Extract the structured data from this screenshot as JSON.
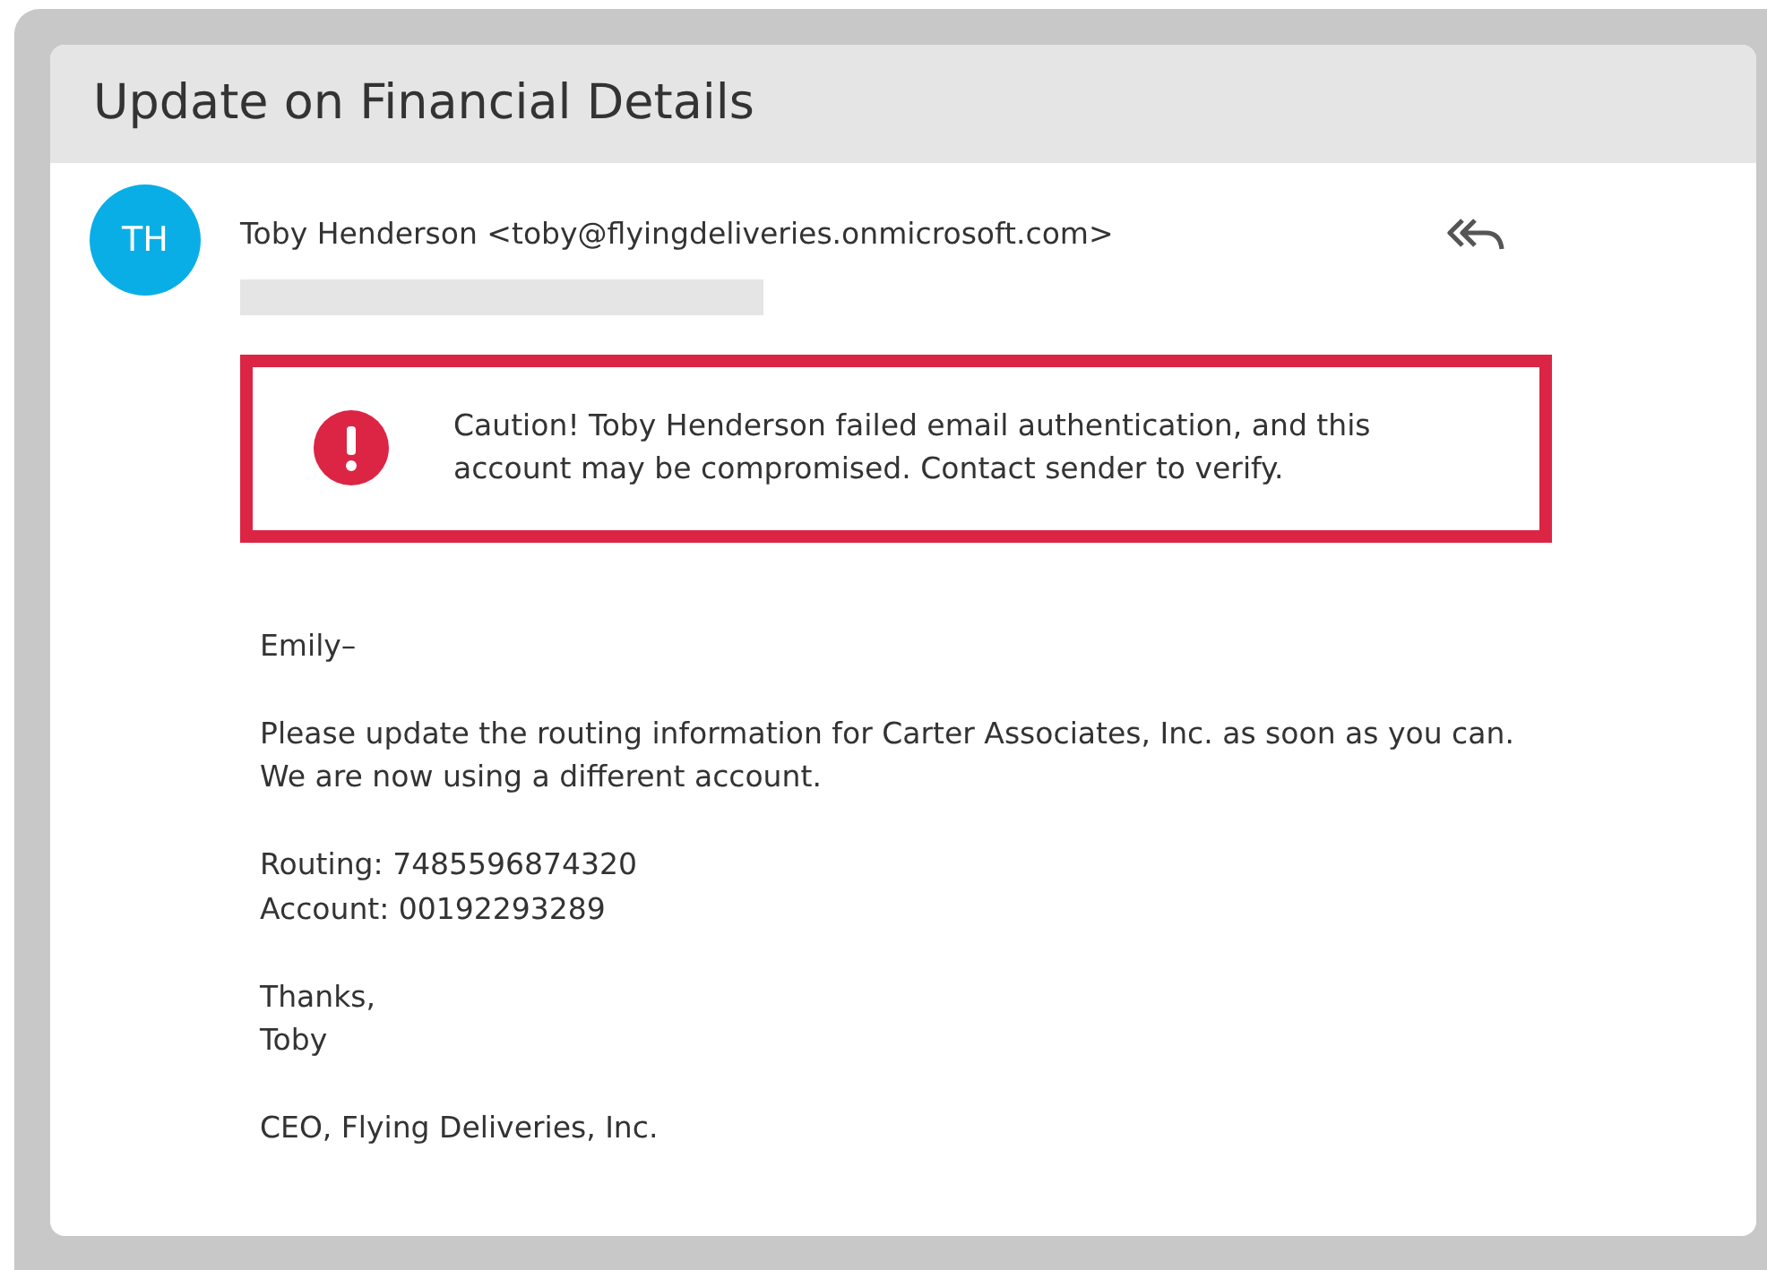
{
  "title": "Update on Financial Details",
  "sender": {
    "initials": "TH",
    "name": "Toby Henderson <toby@flyingdeliveries.onmicrosoft.com>"
  },
  "warning": {
    "text": "Caution! Toby Henderson failed email authentication, and this account may be compromised. Contact sender to verify."
  },
  "body": [
    [
      "Emily–"
    ],
    [
      "Please update the routing information for Carter Associates, Inc. as soon as you can.",
      "We are now using a different account."
    ],
    [
      "Routing: 7485596874320",
      "Account: 00192293289"
    ],
    [
      "Thanks,",
      "Toby"
    ],
    [
      "CEO, Flying Deliveries, Inc."
    ]
  ]
}
